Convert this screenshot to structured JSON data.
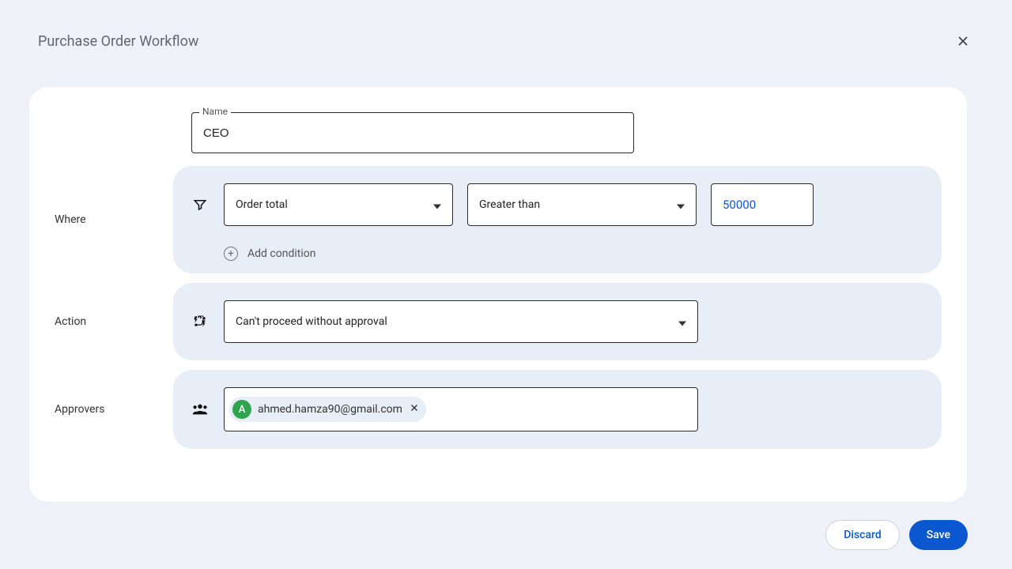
{
  "header": {
    "title": "Purchase Order Workflow"
  },
  "fields": {
    "name_label": "Name",
    "name_value": "CEO",
    "where_label": "Where",
    "condition_field": "Order total",
    "condition_op": "Greater than",
    "condition_value": "50000",
    "add_condition_label": "Add condition",
    "action_label": "Action",
    "action_value": "Can't proceed without approval",
    "approvers_label": "Approvers",
    "approver_initial": "A",
    "approver_email": "ahmed.hamza90@gmail.com"
  },
  "footer": {
    "discard": "Discard",
    "save": "Save"
  }
}
